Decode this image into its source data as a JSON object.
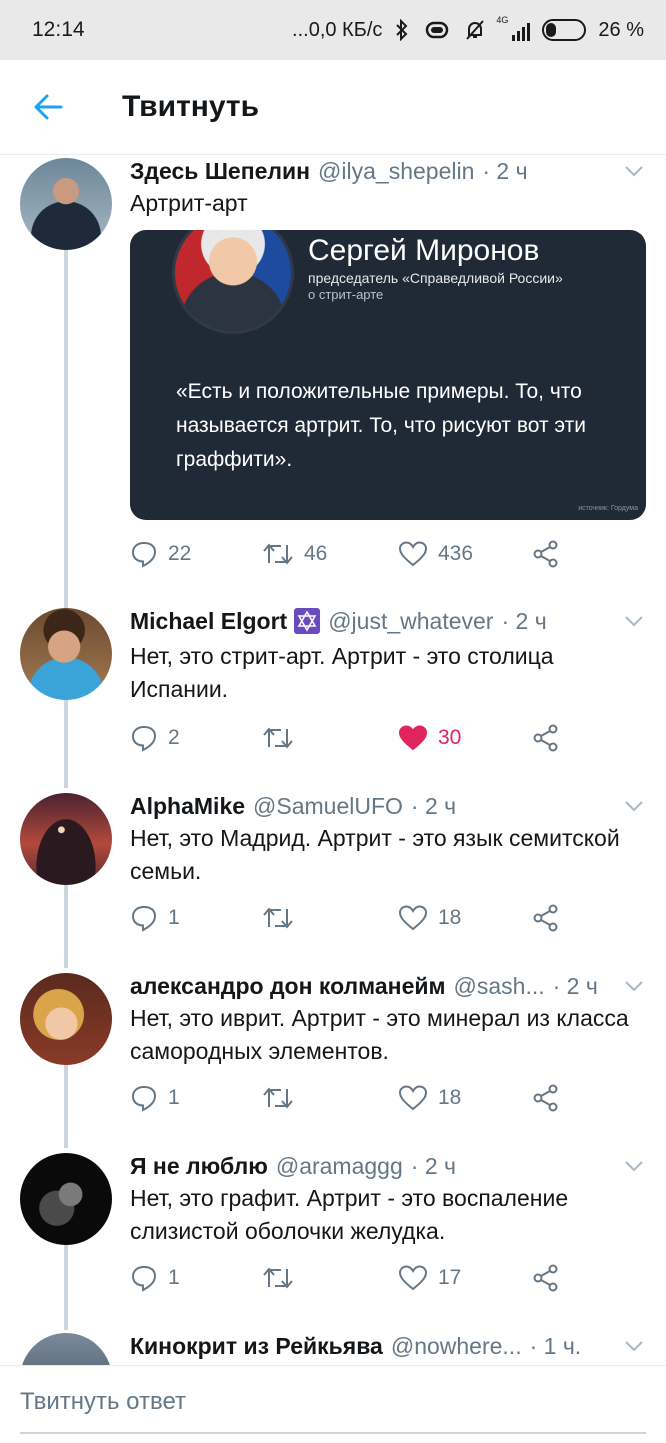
{
  "status_bar": {
    "time": "12:14",
    "network_speed": "...0,0 КБ/с",
    "signal_label": "4G",
    "battery": "26 %"
  },
  "header": {
    "back_icon": "arrow-left-icon",
    "title": "Твитнуть"
  },
  "colors": {
    "accent": "#1da1f2",
    "like_active": "#e0245e",
    "secondary_text": "#657786",
    "thread_line": "#ccd6dd"
  },
  "tweets": [
    {
      "name": "Здесь Шепелин",
      "handle": "@ilya_shepelin",
      "time": "· 2 ч",
      "text": "Артрит-арт",
      "media": {
        "name": "Сергей Миронов",
        "subtitle": "председатель «Справедливой России»",
        "subtitle2": "о стрит-арте",
        "quote": "«Есть и положительные примеры. То, что называется артрит. То, что рисуют вот эти граффити».",
        "source": "источник: Гордума"
      },
      "replies": "22",
      "retweets": "46",
      "likes": "436"
    },
    {
      "name": "Michael Elgort",
      "handle": "@just_whatever",
      "time": "· 2 ч",
      "badge_icon": "star-of-david-icon",
      "text": "Нет, это стрит-арт. Артрит - это столица Испании.",
      "replies": "2",
      "retweets": "",
      "likes": "30",
      "liked": true
    },
    {
      "name": "AlphaMike",
      "handle": "@SamuelUFO",
      "time": "· 2 ч",
      "text": "Нет, это Мадрид. Артрит - это язык семитской семьи.",
      "replies": "1",
      "retweets": "",
      "likes": "18"
    },
    {
      "name": "александро дон колманейм",
      "handle": "@sash...",
      "time": "· 2 ч",
      "text": "Нет, это иврит. Артрит - это минерал из класса самородных элементов.",
      "replies": "1",
      "retweets": "",
      "likes": "18"
    },
    {
      "name": "Я не люблю",
      "handle": "@aramaggg",
      "time": "· 2 ч",
      "text": "Нет, это графит. Артрит - это воспаление слизистой оболочки желудка.",
      "replies": "1",
      "retweets": "",
      "likes": "17"
    },
    {
      "name": "Кинокрит из Рейкьява",
      "handle": "@nowhere...",
      "time": "· 1 ч."
    }
  ],
  "reply_bar": {
    "placeholder": "Твитнуть ответ"
  }
}
